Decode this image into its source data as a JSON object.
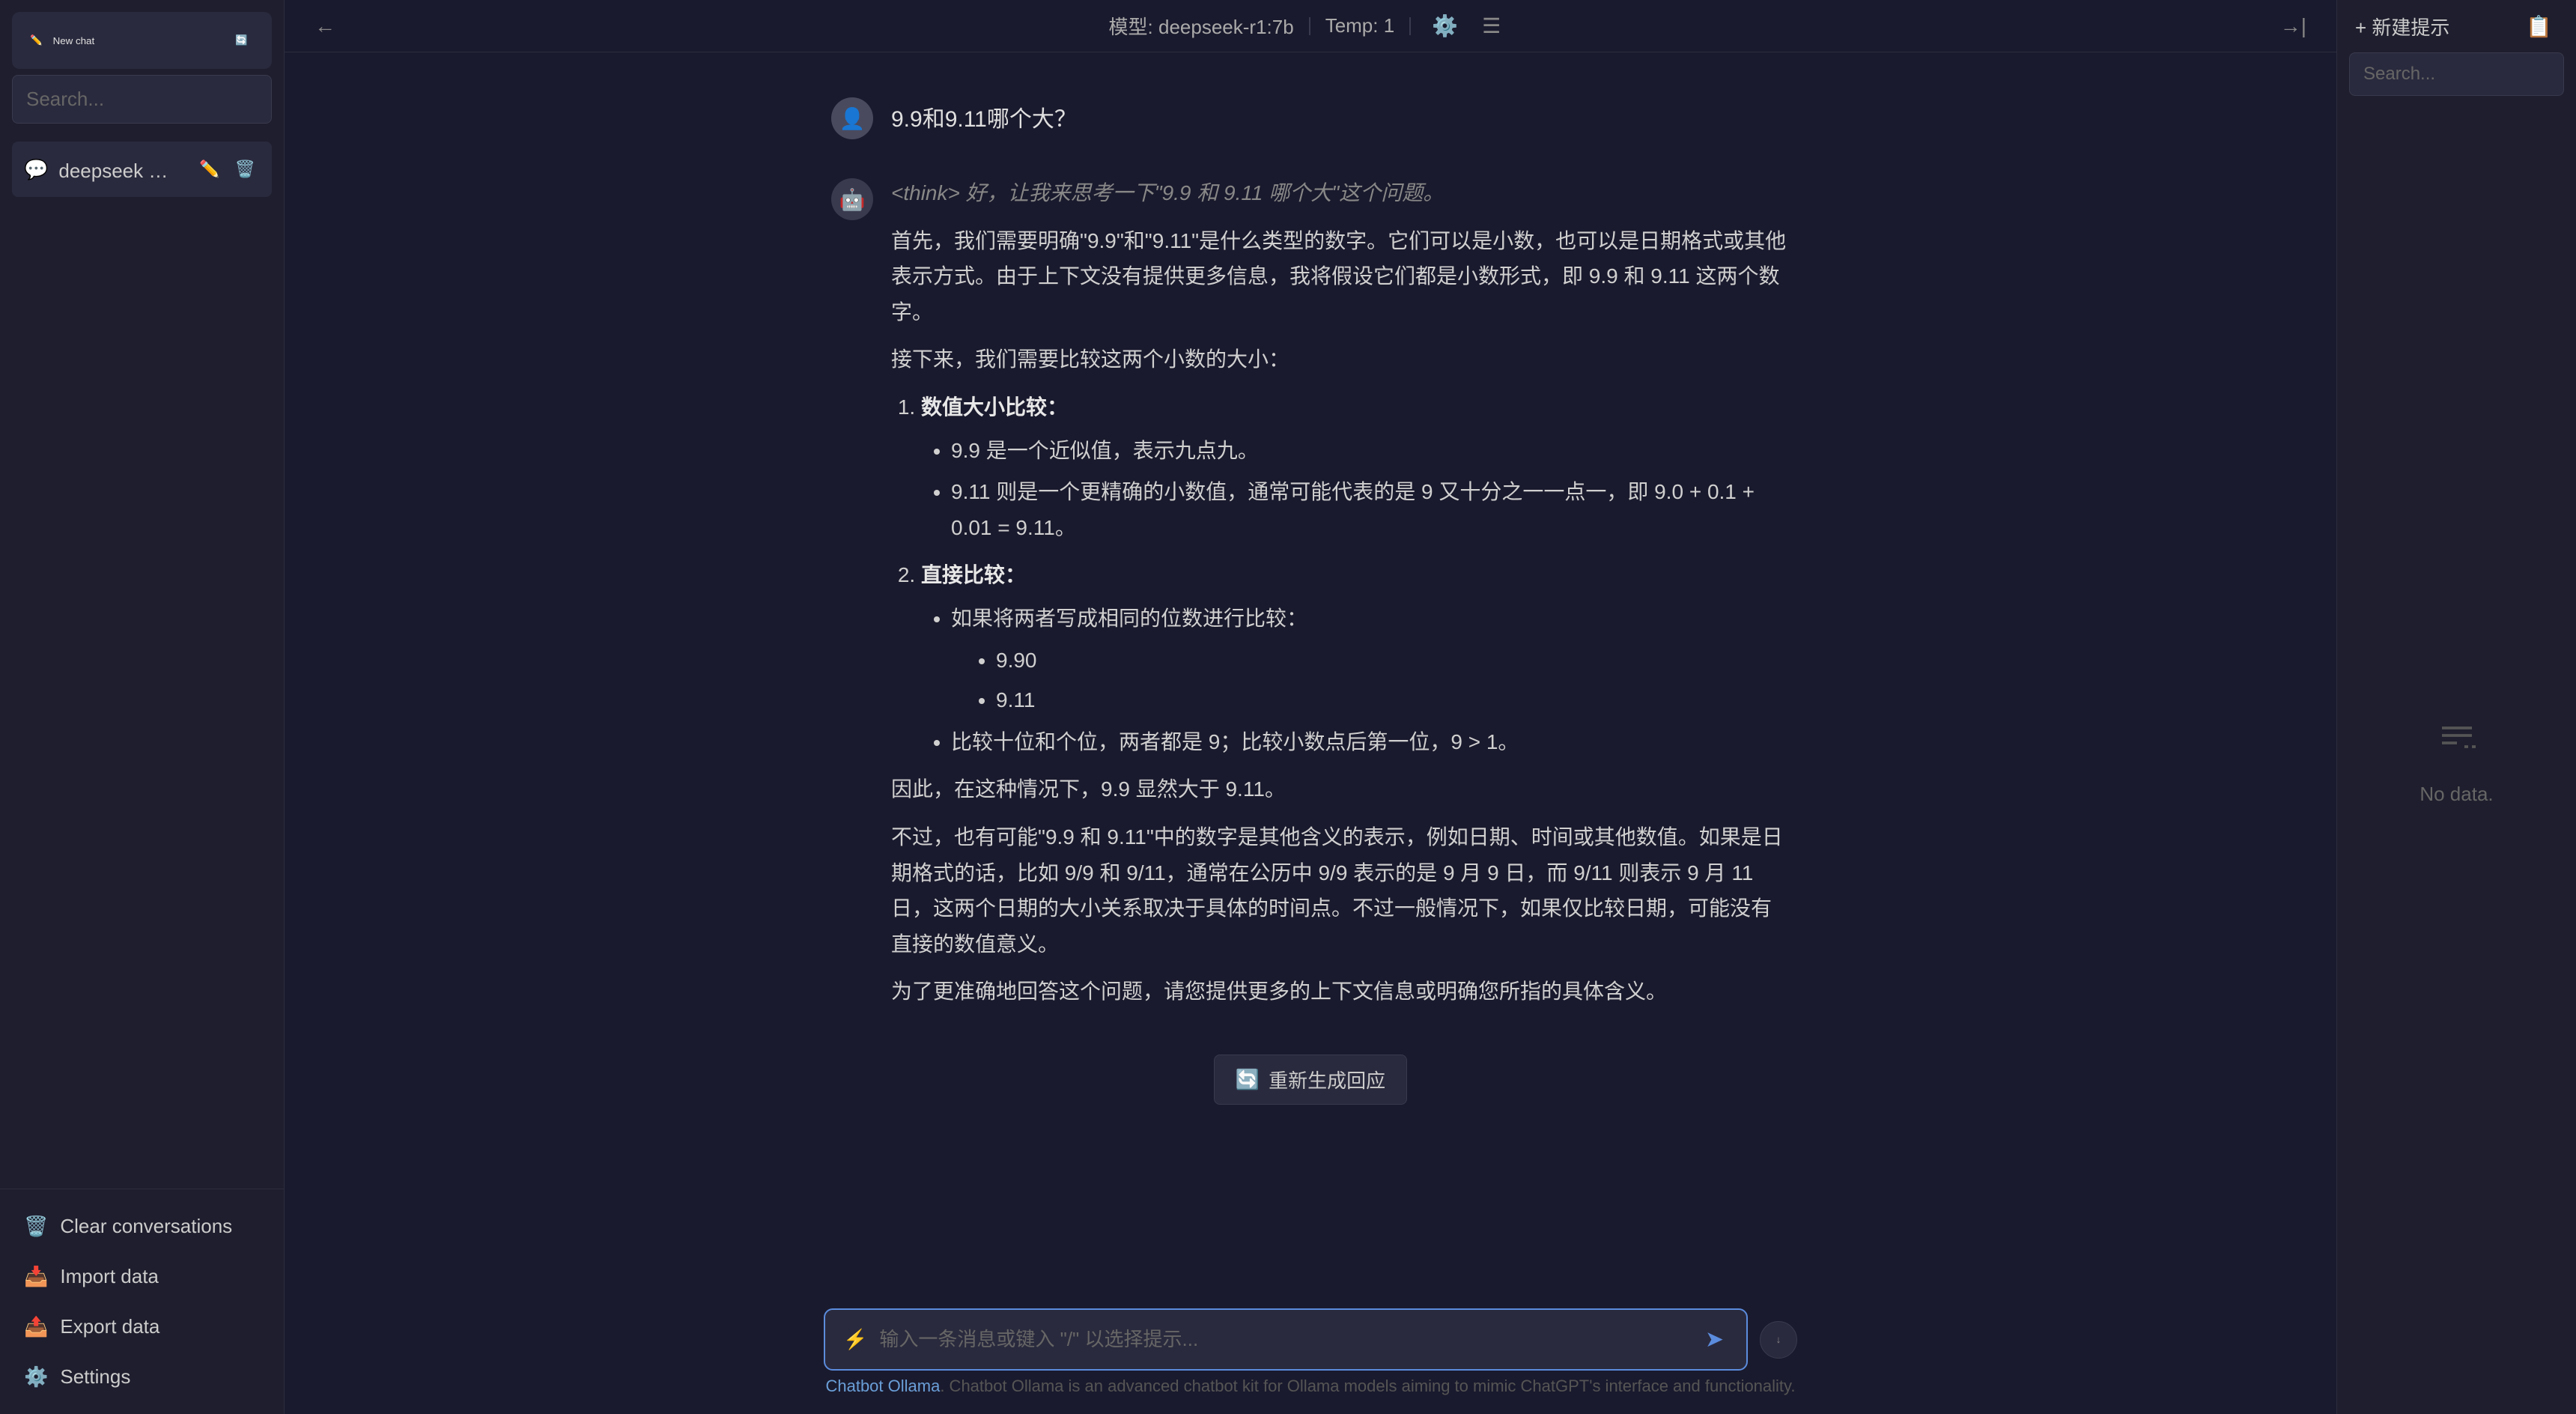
{
  "leftSidebar": {
    "newChatLabel": "New chat",
    "searchPlaceholder": "Search...",
    "conversations": [
      {
        "id": 1,
        "label": "deepseek 和 chatgpt ..."
      }
    ],
    "bottomItems": [
      {
        "id": "clear",
        "label": "Clear conversations",
        "icon": "🗑️"
      },
      {
        "id": "import",
        "label": "Import data",
        "icon": "📥"
      },
      {
        "id": "export",
        "label": "Export data",
        "icon": "📤"
      },
      {
        "id": "settings",
        "label": "Settings",
        "icon": "⚙️"
      }
    ]
  },
  "header": {
    "modelLabel": "模型: deepseek-r1:7b",
    "tempLabel": "Temp: 1",
    "backLabel": "←",
    "forwardLabel": "→"
  },
  "chat": {
    "userMessage": "9.9和9.11哪个大？",
    "assistantThink": "<think> 好，让我来思考一下\"9.9 和 9.11 哪个大\"这个问题。",
    "assistantLines": [
      "首先，我们需要明确\"9.9\"和\"9.11\"是什么类型的数字。它们可以是小数，也可以是日期格式或其他表示方式。由于上下文没有提供更多信息，我将假设它们都是小数形式，即 9.9 和 9.11 这两个数字。",
      "接下来，我们需要比较这两个小数的大小："
    ],
    "sections": [
      {
        "number": 1,
        "title": "数值大小比较：",
        "bullets": [
          "9.9 是一个近似值，表示九点九。",
          "9.11 则是一个更精确的小数值，通常可能代表的是 9 又十分之一一点一，即 9.0 + 0.1 + 0.01 = 9.11。"
        ]
      },
      {
        "number": 2,
        "title": "直接比较：",
        "bullets": [
          {
            "text": "如果将两者写成相同的位数进行比较：",
            "subBullets": [
              "9.90",
              "9.11"
            ]
          },
          "比较十位和个位，两者都是 9；比较小数点后第一位，9 > 1。"
        ]
      }
    ],
    "conclusion1": "因此，在这种情况下，9.9 显然大于 9.11。",
    "conclusion2": "不过，也有可能\"9.9 和 9.11\"中的数字是其他含义的表示，例如日期、时间或其他数值。如果是日期格式的话，比如 9/9 和 9/11，通常在公历中 9/9 表示的是 9 月 9 日，而 9/11 则表示 9 月 11 日，这两个日期的大小关系取决于具体的时间点。不过一般情况下，如果仅比较日期，可能没有直接的数值意义。",
    "conclusion3": "为了更准确地回答这个问题，请您提供更多的上下文信息或明确您所指的具体含义。",
    "regenerateLabel": "重新生成回应",
    "inputPlaceholder": "输入一条消息或键入 \"/\" 以选择提示...",
    "footerText1": "Chatbot Ollama",
    "footerText2": ". Chatbot Ollama is an advanced chatbot kit for Ollama models aiming to mimic ChatGPT's interface and functionality."
  },
  "rightSidebar": {
    "newPromptLabel": "+ 新建提示",
    "searchPlaceholder": "Search...",
    "noDataLabel": "No data.",
    "pinLabel": "→|"
  }
}
